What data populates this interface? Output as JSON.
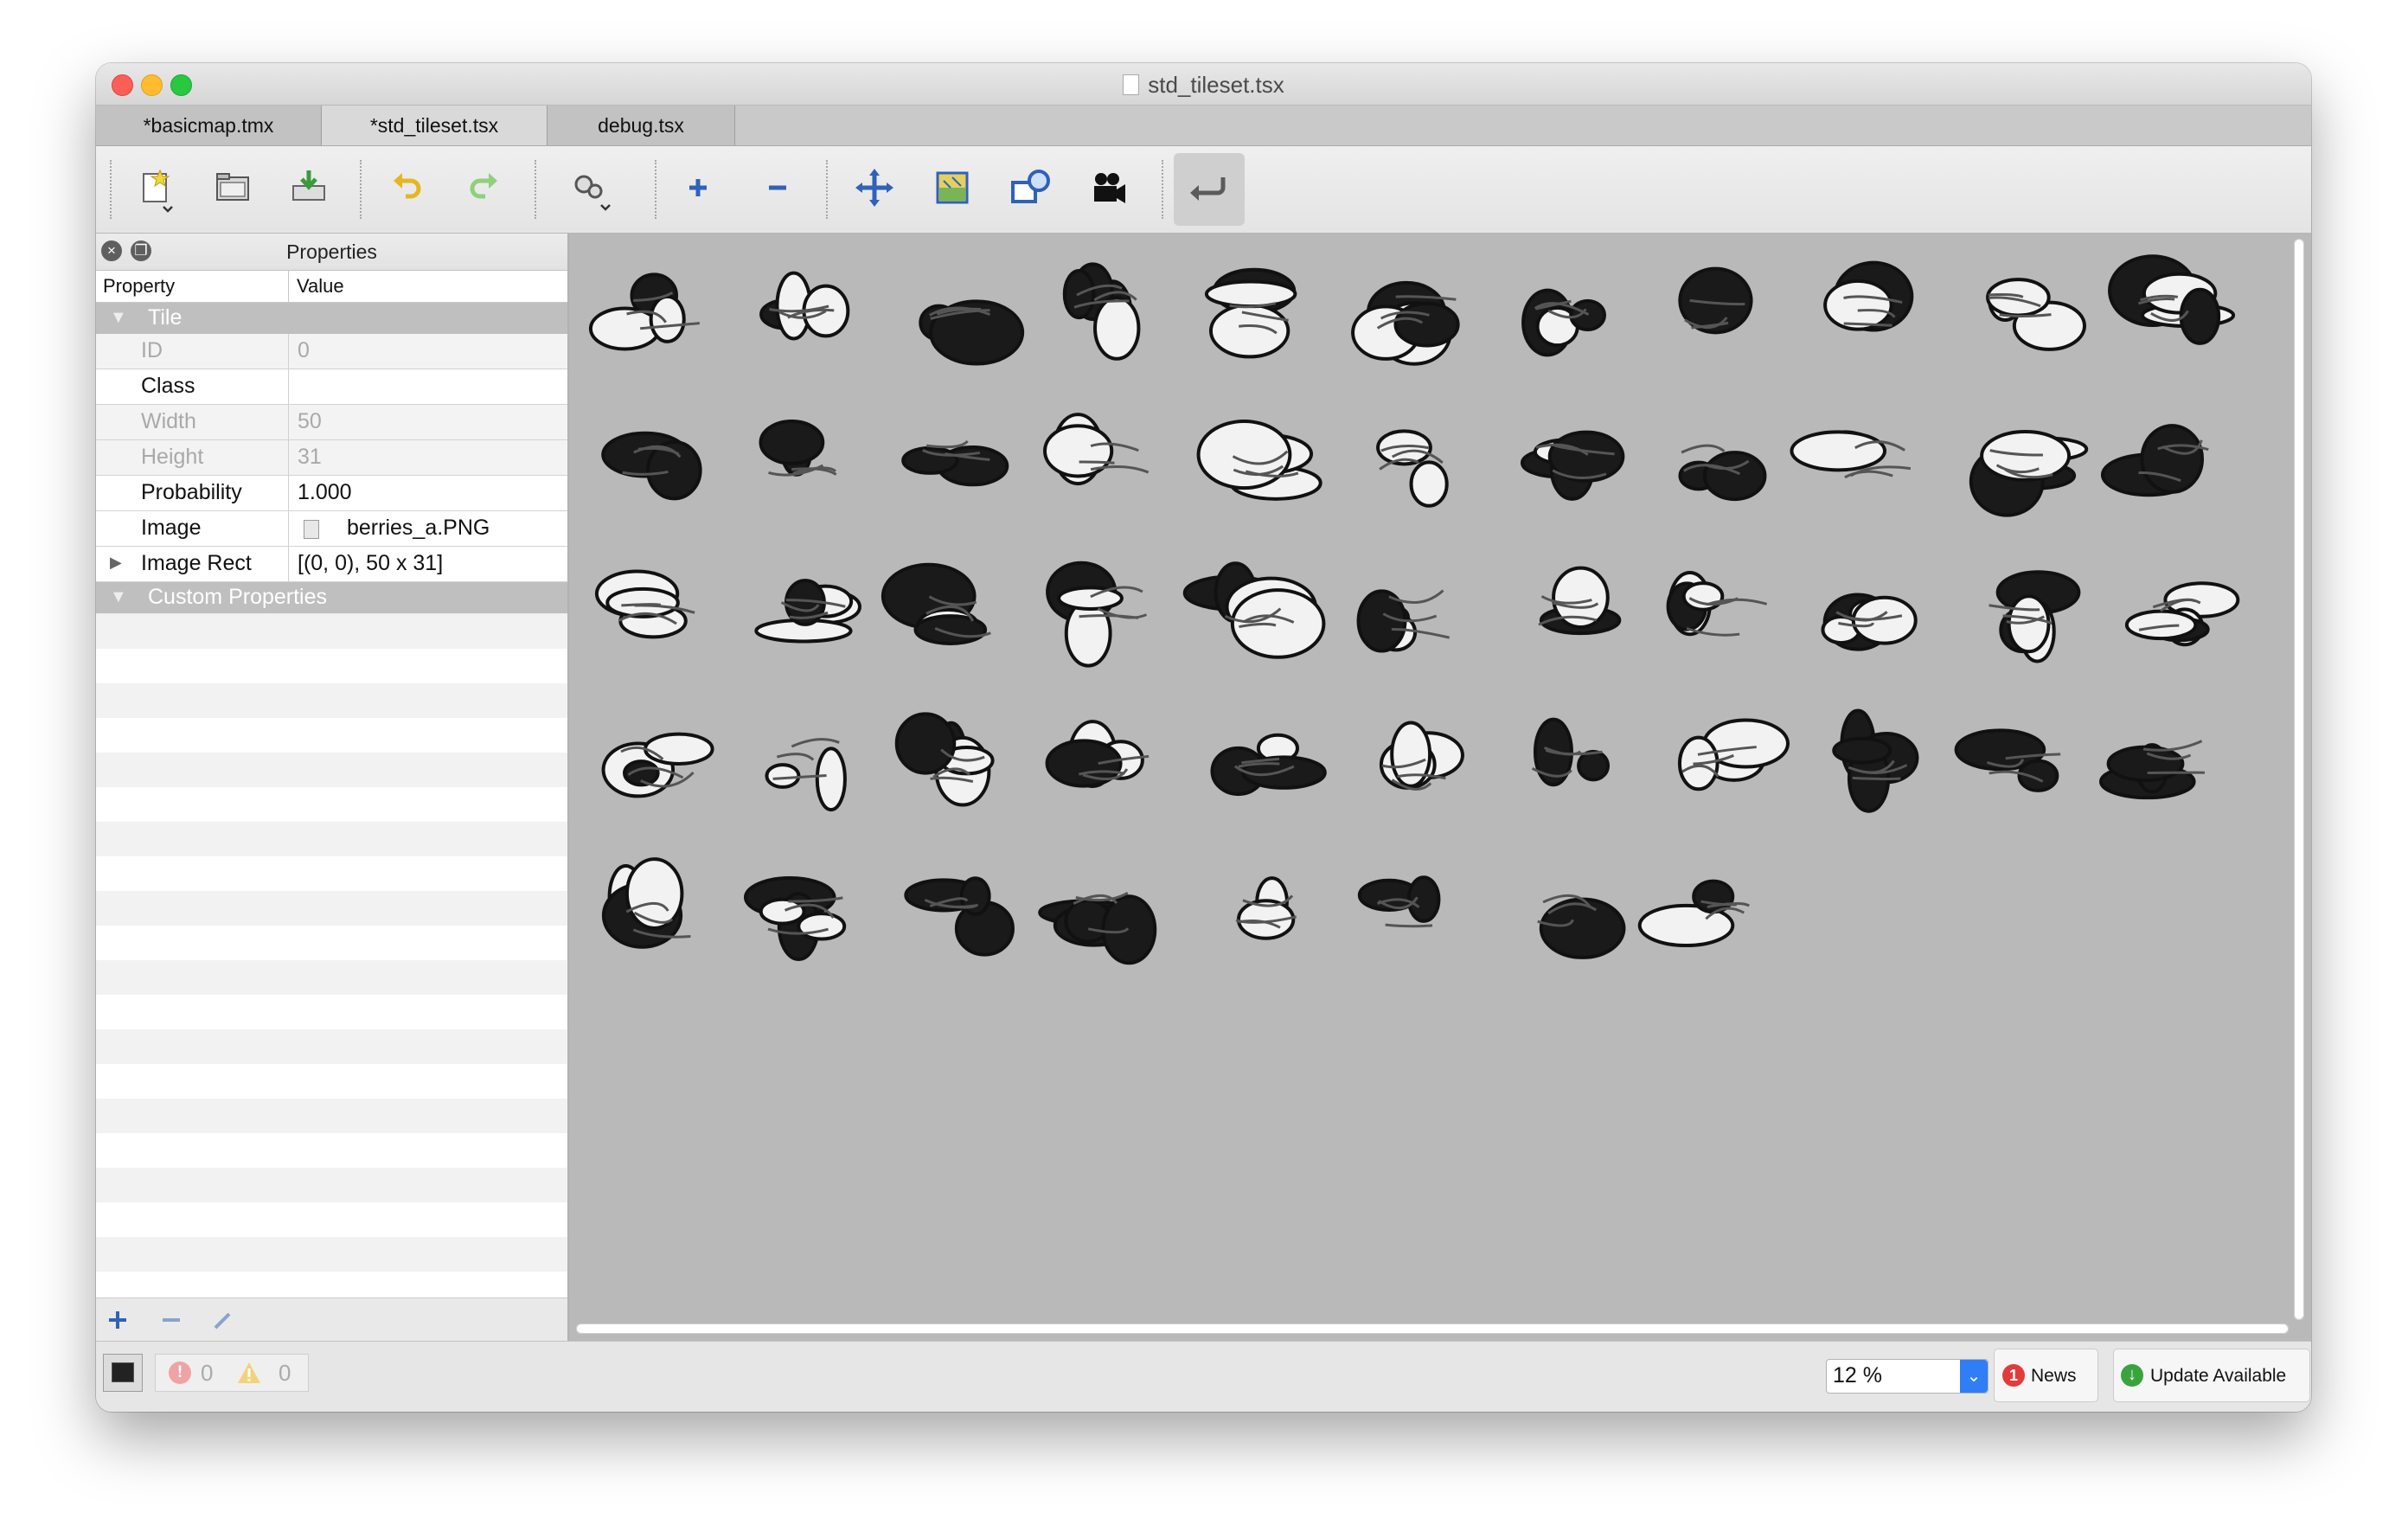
{
  "window": {
    "title": "std_tileset.tsx"
  },
  "tabs": [
    {
      "label": "*basicmap.tmx"
    },
    {
      "label": "*std_tileset.tsx"
    },
    {
      "label": "debug.tsx"
    }
  ],
  "toolbar": {
    "icons": [
      "new-tileset-icon",
      "open-icon",
      "save-icon",
      "undo-icon",
      "redo-icon",
      "tileset-properties-icon",
      "add-tiles-icon",
      "remove-tiles-icon",
      "dynamic-wrapping-icon",
      "edit-terrain-icon",
      "edit-collision-icon",
      "edit-animation-icon",
      "return-icon"
    ]
  },
  "properties_panel": {
    "title": "Properties",
    "columns": {
      "property": "Property",
      "value": "Value"
    },
    "groups": {
      "tile": "Tile",
      "custom": "Custom Properties"
    },
    "rows": [
      {
        "key": "ID",
        "value": "0",
        "enabled": false
      },
      {
        "key": "Class",
        "value": "",
        "enabled": true
      },
      {
        "key": "Width",
        "value": "50",
        "enabled": false
      },
      {
        "key": "Height",
        "value": "31",
        "enabled": false
      },
      {
        "key": "Probability",
        "value": "1.000",
        "enabled": true
      },
      {
        "key": "Image",
        "value": "berries_a.PNG",
        "enabled": true
      },
      {
        "key": "Image Rect",
        "value": "[(0, 0), 50 x 31]",
        "enabled": true
      }
    ]
  },
  "status": {
    "errors": "0",
    "warnings": "0",
    "zoom": "12 %",
    "news_count": "1",
    "news_label": "News",
    "update_label": "Update Available"
  },
  "colors": {
    "accent": "#2f7ef6",
    "tile_bg": "#b9b9b9",
    "group_row": "#bfbfbf"
  }
}
